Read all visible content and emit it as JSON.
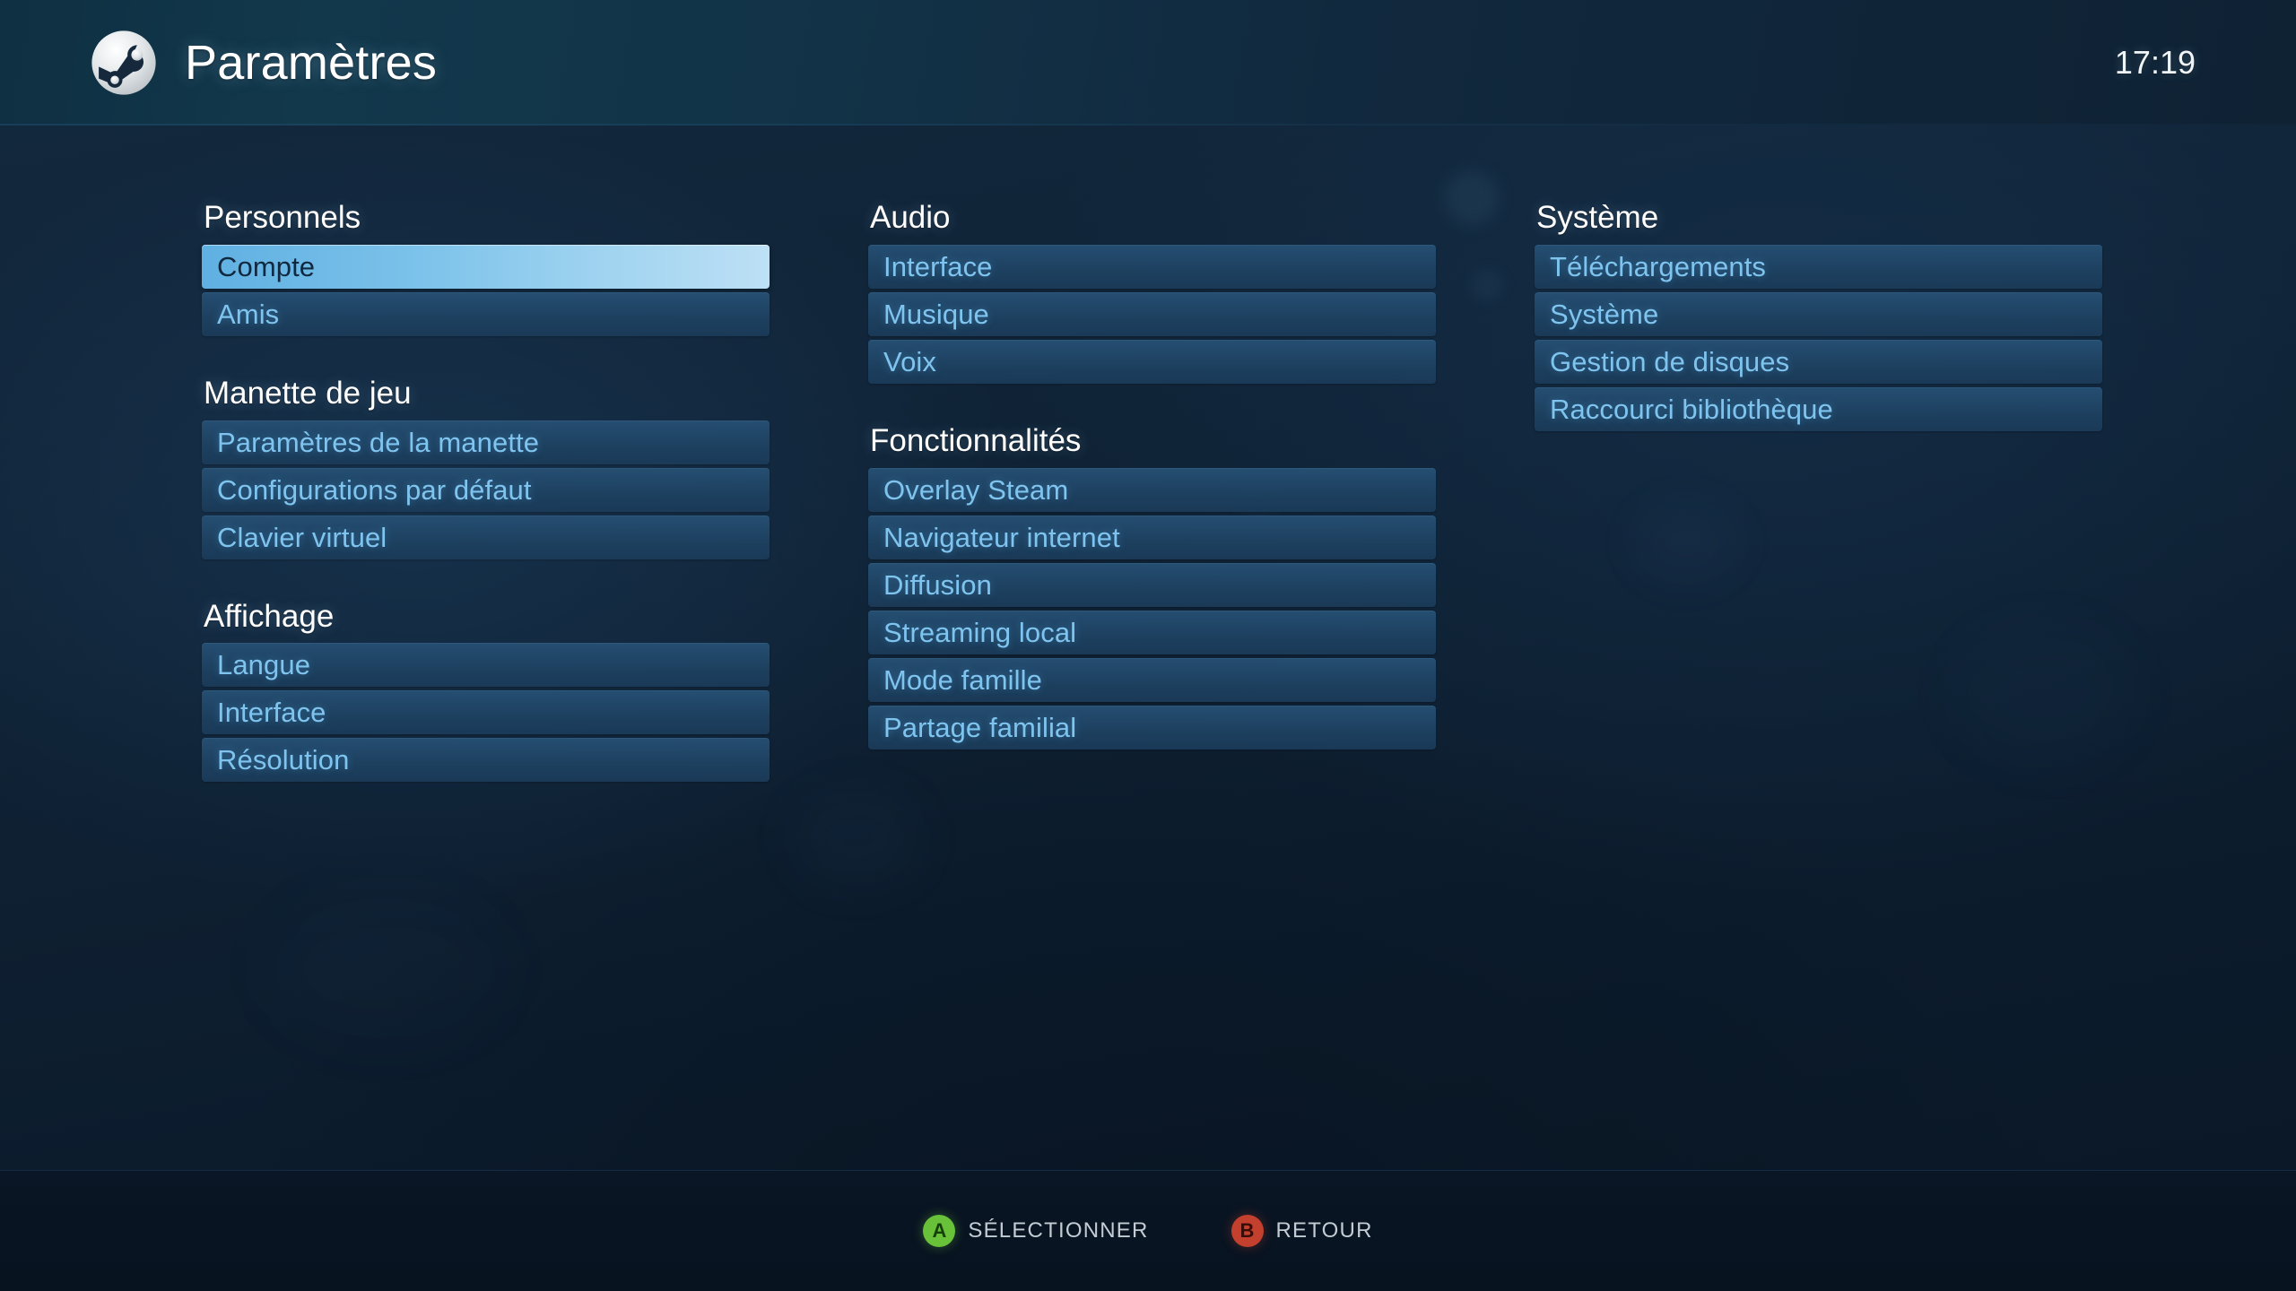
{
  "header": {
    "logo_icon": "steam-logo-icon",
    "title": "Paramètres",
    "clock": "17:19"
  },
  "colors": {
    "accent_selected_start": "#5fb0e2",
    "accent_selected_end": "#bde0f5",
    "item_text": "#7fc4ef",
    "selected_item_text": "#10293f",
    "heading_text": "#ffffff",
    "background": "#0c1c2d",
    "header_gradient_start": "#0f2f42",
    "header_gradient_end": "#0f2234",
    "footer_background": "#091422",
    "button_a": "#69c13a",
    "button_b": "#c4402e",
    "footer_label": "#c3ccd4"
  },
  "columns": [
    {
      "name": "column-1",
      "sections": [
        {
          "title": "Personnels",
          "items": [
            {
              "label": "Compte",
              "selected": true
            },
            {
              "label": "Amis",
              "selected": false
            }
          ]
        },
        {
          "title": "Manette de jeu",
          "items": [
            {
              "label": "Paramètres de la manette",
              "selected": false
            },
            {
              "label": "Configurations par défaut",
              "selected": false
            },
            {
              "label": "Clavier virtuel",
              "selected": false
            }
          ]
        },
        {
          "title": "Affichage",
          "items": [
            {
              "label": "Langue",
              "selected": false
            },
            {
              "label": "Interface",
              "selected": false
            },
            {
              "label": "Résolution",
              "selected": false
            }
          ]
        }
      ]
    },
    {
      "name": "column-2",
      "sections": [
        {
          "title": "Audio",
          "items": [
            {
              "label": "Interface",
              "selected": false
            },
            {
              "label": "Musique",
              "selected": false
            },
            {
              "label": "Voix",
              "selected": false
            }
          ]
        },
        {
          "title": "Fonctionnalités",
          "items": [
            {
              "label": "Overlay Steam",
              "selected": false
            },
            {
              "label": "Navigateur internet",
              "selected": false
            },
            {
              "label": "Diffusion",
              "selected": false
            },
            {
              "label": "Streaming local",
              "selected": false
            },
            {
              "label": "Mode famille",
              "selected": false
            },
            {
              "label": "Partage familial",
              "selected": false
            }
          ]
        }
      ]
    },
    {
      "name": "column-3",
      "sections": [
        {
          "title": "Système",
          "items": [
            {
              "label": "Téléchargements",
              "selected": false
            },
            {
              "label": "Système",
              "selected": false
            },
            {
              "label": "Gestion de disques",
              "selected": false
            },
            {
              "label": "Raccourci bibliothèque",
              "selected": false
            }
          ]
        }
      ]
    }
  ],
  "footer": {
    "hints": [
      {
        "button": "A",
        "label": "SÉLECTIONNER",
        "icon": "button-a-icon"
      },
      {
        "button": "B",
        "label": "RETOUR",
        "icon": "button-b-icon"
      }
    ]
  }
}
